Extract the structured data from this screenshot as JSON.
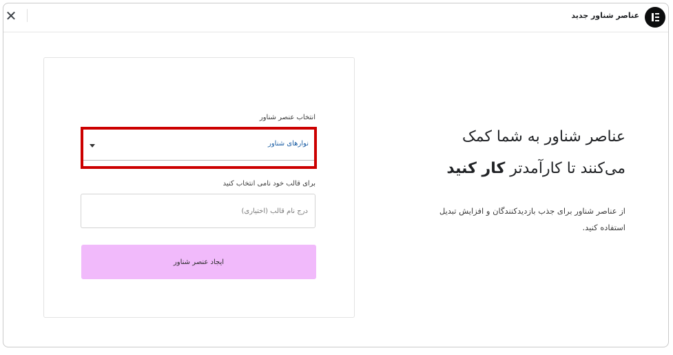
{
  "header": {
    "title": "عناصر شناور جدید",
    "close_symbol": "✕"
  },
  "form": {
    "select_label": "انتخاب عنصر شناور",
    "select_value": "نوارهای شناور",
    "name_label": "برای قالب خود نامی انتخاب کنید",
    "name_placeholder": "درج نام قالب (اختیاری)",
    "create_label": "ایجاد عنصر شناور"
  },
  "intro": {
    "headline_line1": "عناصر شناور به شما کمک",
    "headline_line2_regular": "می‌کنند تا کارآمدتر",
    "headline_line2_bold": "کار کنید",
    "description": "از عناصر شناور برای جذب بازدیدکنندگان و افزایش تبدیل استفاده کنید."
  },
  "icons": {
    "logo": "elementor-logo-icon",
    "close": "close-icon",
    "caret": "caret-down-icon"
  },
  "colors": {
    "highlight_border": "#cc0000",
    "button_bg": "#f1bafb",
    "select_value": "#1d5fa5"
  }
}
